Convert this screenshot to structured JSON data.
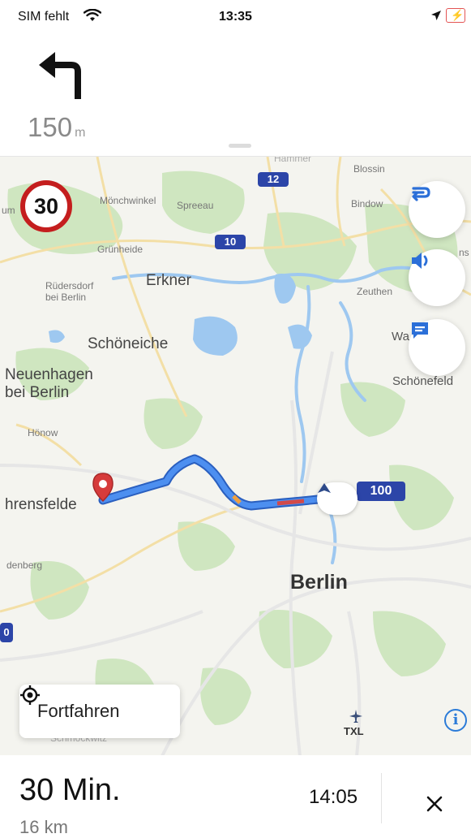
{
  "status_bar": {
    "carrier": "SIM fehlt",
    "time": "13:35",
    "icons": [
      "wifi-icon",
      "location-arrow-icon",
      "battery-charging-icon"
    ]
  },
  "maneuver": {
    "icon": "turn-left-arrow-icon",
    "distance_value": "150",
    "distance_unit": "m"
  },
  "map": {
    "speed_limit": "30",
    "places": {
      "moenchwinkel": "Mönchwinkel",
      "spreeau": "Spreeau",
      "gruenheide": "Grünheide",
      "ruedersdorf": "Rüdersdorf\nbei Berlin",
      "erkner": "Erkner",
      "schoeneiche": "Schöneiche",
      "neuenhagen": "Neuenhagen\nbei Berlin",
      "hoenow": "Hönow",
      "ahrensfelde": "hrensfelde",
      "falkenberg": "denberg",
      "berlin": "Berlin",
      "blossin": "Blossin",
      "bindow": "Bindow",
      "zeuthen": "Zeuthen",
      "wa": "Wa",
      "schoenefeld": "Schönefeld",
      "schmoeckwitz": "Schmöckwitz",
      "um": "um",
      "hammer": "Hammer",
      "edge_letter": "ns",
      "txl": "TXL"
    },
    "road_shields": [
      "12",
      "10",
      "100",
      "0"
    ],
    "buttons": {
      "route_options_icon": "route-options-icon",
      "sound_icon": "speaker-icon",
      "report_icon": "chat-report-icon",
      "resume_label": "Fortfahren",
      "resume_icon": "recenter-target-icon",
      "info_icon": "info-icon"
    },
    "route_color": "#3d7ee0",
    "destination_pin_color": "#d63b3b"
  },
  "bottom_sheet": {
    "duration": "30 Min.",
    "distance": "16 km",
    "arrival_time": "14:05",
    "close_icon": "close-icon"
  }
}
